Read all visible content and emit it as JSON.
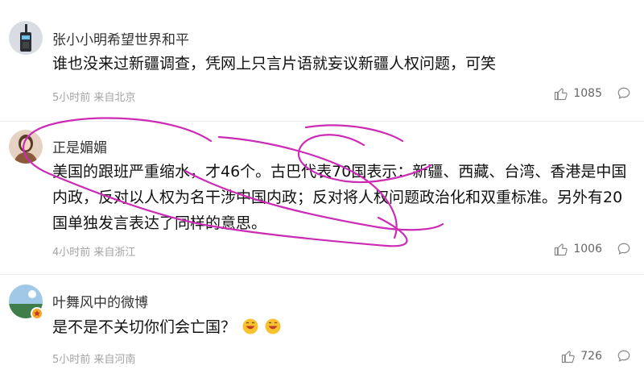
{
  "comments": [
    {
      "username": "张小小明希望世界和平",
      "text": "谁也没来过新疆调查，凭网上只言片语就妄议新疆人权问题，可笑",
      "meta": "5小时前 来自北京",
      "likes": "1085",
      "avatar_icon": "walkie-talkie-avatar"
    },
    {
      "username": "正是媚媚",
      "text": "美国的跟班严重缩水，才46个。古巴代表70国表示：新疆、西藏、台湾、香港是中国内政，反对以人权为名干涉中国内政；反对将人权问题政治化和双重标准。另外有20国单独发言表达了同样的意思。",
      "meta": "4小时前 来自浙江",
      "likes": "1006",
      "avatar_icon": "woman-portrait-avatar"
    },
    {
      "username": "叶舞风中的微博",
      "text": "是不是不关切你们会亡国？",
      "meta": "5小时前 来自河南",
      "likes": "726",
      "avatar_icon": "landscape-avatar",
      "emoji": "laughing-emoji"
    }
  ],
  "colors": {
    "scribble": "#cc2bb5",
    "meta_gray": "#a3a3a3",
    "verified_badge": "#f5a623"
  }
}
